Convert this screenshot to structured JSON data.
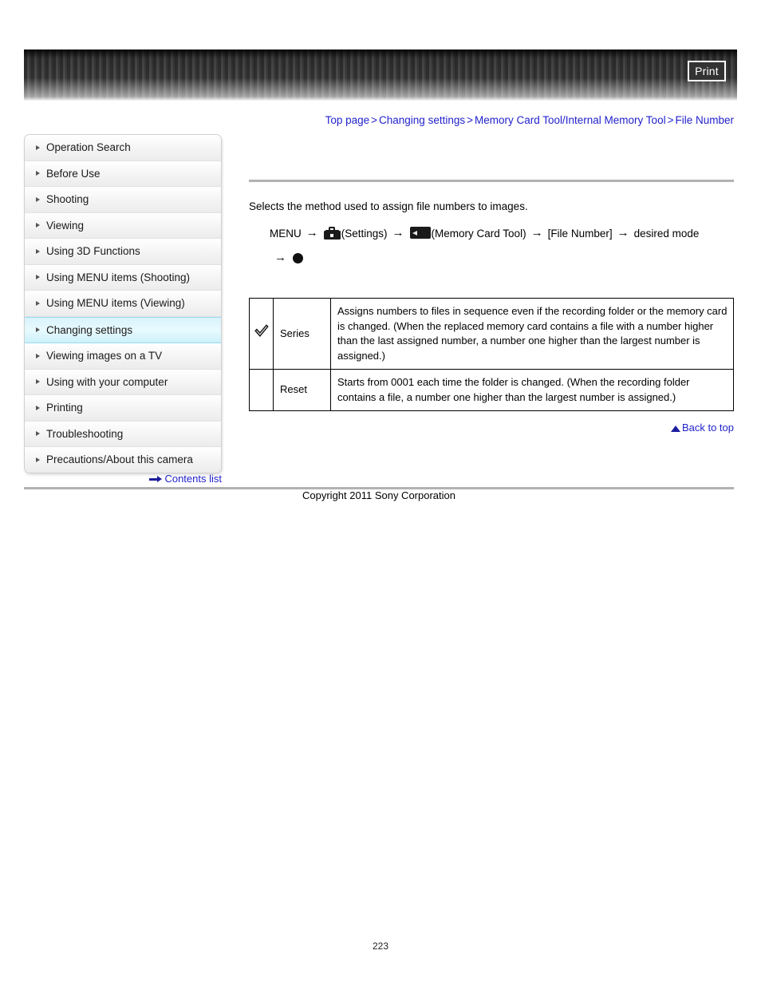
{
  "header": {
    "print_label": "Print",
    "band_icon": "striped-banner"
  },
  "breadcrumb": {
    "items": [
      {
        "label": "Top page"
      },
      {
        "label": "Changing settings"
      },
      {
        "label": "Memory Card Tool/Internal Memory Tool"
      },
      {
        "label": "File Number"
      }
    ],
    "separator": ">"
  },
  "sidebar": {
    "items": [
      {
        "label": "Operation Search",
        "active": false
      },
      {
        "label": "Before Use",
        "active": false
      },
      {
        "label": "Shooting",
        "active": false
      },
      {
        "label": "Viewing",
        "active": false
      },
      {
        "label": "Using 3D Functions",
        "active": false
      },
      {
        "label": "Using MENU items (Shooting)",
        "active": false
      },
      {
        "label": "Using MENU items (Viewing)",
        "active": false
      },
      {
        "label": "Changing settings",
        "active": true
      },
      {
        "label": "Viewing images on a TV",
        "active": false
      },
      {
        "label": "Using with your computer",
        "active": false
      },
      {
        "label": "Printing",
        "active": false
      },
      {
        "label": "Troubleshooting",
        "active": false
      },
      {
        "label": "Precautions/About this camera",
        "active": false
      }
    ]
  },
  "main": {
    "intro": "Selects the method used to assign file numbers to images.",
    "menu_path": {
      "start": "MENU",
      "settings_label": "(Settings)",
      "memcard_label": "(Memory Card Tool)",
      "item_label": "[File Number]",
      "mode_label": "desired mode",
      "arrow": "→"
    },
    "table": {
      "rows": [
        {
          "checked": true,
          "name": "Series",
          "description": "Assigns numbers to files in sequence even if the recording folder or the memory card is changed. (When the replaced memory card contains a file with a number higher than the last assigned number, a number one higher than the largest number is assigned.)"
        },
        {
          "checked": false,
          "name": "Reset",
          "description": "Starts from 0001 each time the folder is changed. (When the recording folder contains a file, a number one higher than the largest number is assigned.)"
        }
      ]
    }
  },
  "links": {
    "back_to_top": "Back to top",
    "contents_list": "Contents list"
  },
  "footer": {
    "copyright": "Copyright 2011 Sony Corporation",
    "page_number": "223"
  },
  "colors": {
    "link": "#2222cc",
    "active_sidebar": "#d8f3fb",
    "rule": "#b2b2b2",
    "banner": "#3a3a3a"
  }
}
